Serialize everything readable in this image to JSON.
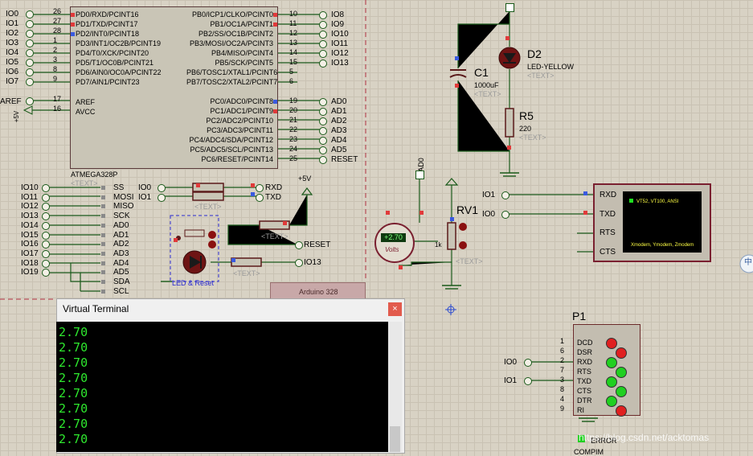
{
  "mcu": {
    "name": "ATMEGA328P",
    "text_tag": "<TEXT>",
    "left_pins": [
      {
        "num": "26",
        "name": "PD0/RXD/PCINT16",
        "net": "IO0"
      },
      {
        "num": "27",
        "name": "PD1/TXD/PCINT17",
        "net": "IO1"
      },
      {
        "num": "28",
        "name": "PD2/INT0/PCINT18",
        "net": "IO2"
      },
      {
        "num": "1",
        "name": "PD3/INT1/OC2B/PCINT19",
        "net": "IO3"
      },
      {
        "num": "2",
        "name": "PD4/T0/XCK/PCINT20",
        "net": "IO4"
      },
      {
        "num": "3",
        "name": "PD5/T1/OC0B/PCINT21",
        "net": "IO5"
      },
      {
        "num": "8",
        "name": "PD6/AIN0/OC0A/PCINT22",
        "net": "IO6"
      },
      {
        "num": "9",
        "name": "PD7/AIN1/PCINT23",
        "net": "IO7"
      }
    ],
    "aref_pins": [
      {
        "num": "17",
        "name": "AREF",
        "net": "AREF"
      },
      {
        "num": "16",
        "name": "AVCC",
        "net": "+5V"
      }
    ],
    "right_pins_top": [
      {
        "num": "10",
        "name": "PB0/ICP1/CLKO/PCINT0",
        "net": "IO8"
      },
      {
        "num": "11",
        "name": "PB1/OC1A/PCINT1",
        "net": "IO9"
      },
      {
        "num": "12",
        "name": "PB2/SS/OC1B/PCINT2",
        "net": "IO10"
      },
      {
        "num": "13",
        "name": "PB3/MOSI/OC2A/PCINT3",
        "net": "IO11"
      },
      {
        "num": "14",
        "name": "PB4/MISO/PCINT4",
        "net": "IO12"
      },
      {
        "num": "15",
        "name": "PB5/SCK/PCINT5",
        "net": "IO13"
      },
      {
        "num": "5",
        "name": "PB6/TOSC1/XTAL1/PCINT6",
        "net": ""
      },
      {
        "num": "6",
        "name": "PB7/TOSC2/XTAL2/PCINT7",
        "net": ""
      }
    ],
    "right_pins_bottom": [
      {
        "num": "19",
        "name": "PC0/ADC0/PCINT8",
        "net": "AD0"
      },
      {
        "num": "20",
        "name": "PC1/ADC1/PCINT9",
        "net": "AD1"
      },
      {
        "num": "21",
        "name": "PC2/ADC2/PCINT10",
        "net": "AD2"
      },
      {
        "num": "22",
        "name": "PC3/ADC3/PCINT11",
        "net": "AD3"
      },
      {
        "num": "23",
        "name": "PC4/ADC4/SDA/PCINT12",
        "net": "AD4"
      },
      {
        "num": "24",
        "name": "PC5/ADC5/SCL/PCINT13",
        "net": "AD5"
      },
      {
        "num": "25",
        "name": "PC6/RESET/PCINT14",
        "net": "RESET"
      }
    ]
  },
  "header_nets": [
    {
      "net": "IO10",
      "label": "SS"
    },
    {
      "net": "IO11",
      "label": "MOSI"
    },
    {
      "net": "IO12",
      "label": "MISO"
    },
    {
      "net": "IO13",
      "label": "SCK"
    },
    {
      "net": "IO14",
      "label": "AD0"
    },
    {
      "net": "IO15",
      "label": "AD1"
    },
    {
      "net": "IO16",
      "label": "AD2"
    },
    {
      "net": "IO17",
      "label": "AD3"
    },
    {
      "net": "IO18",
      "label": "AD4"
    },
    {
      "net": "IO19",
      "label": "AD5"
    },
    {
      "net": "",
      "label": "SDA"
    },
    {
      "net": "",
      "label": "SCL"
    }
  ],
  "serial_links": [
    {
      "left": "IO0",
      "right": "RXD"
    },
    {
      "left": "IO1",
      "right": "TXD"
    }
  ],
  "plus5v": "+5V",
  "reset_block": {
    "label": "LED & Reset",
    "net_reset": "RESET",
    "net_io13": "IO13",
    "text_tag": "<TEXT>"
  },
  "arduino_label": "Arduino 328",
  "capacitor": {
    "ref": "C1",
    "value": "1000uF",
    "text_tag": "<TEXT>"
  },
  "led": {
    "ref": "D2",
    "value": "LED-YELLOW",
    "text_tag": "<TEXT>"
  },
  "resistor": {
    "ref": "R5",
    "value": "220",
    "text_tag": "<TEXT>"
  },
  "pot": {
    "ref": "RV1",
    "value": "1k",
    "net": "AD0",
    "text_tag": "<TEXT>"
  },
  "voltmeter": {
    "reading": "+2.70",
    "unit": "Volts"
  },
  "terminal_device": {
    "pins": [
      "RXD",
      "TXD",
      "RTS",
      "CTS"
    ],
    "nets": [
      "IO1",
      "IO0"
    ],
    "screen_line1": "VT52, VT100, ANSI",
    "screen_line2": "Xmodem, Ymodem, Zmodem"
  },
  "p1": {
    "ref": "P1",
    "pins": [
      {
        "num": "1",
        "name": "DCD",
        "color": "#e02020"
      },
      {
        "num": "6",
        "name": "DSR",
        "color": "#e02020"
      },
      {
        "num": "2",
        "name": "RXD",
        "color": "#20d020"
      },
      {
        "num": "7",
        "name": "RTS",
        "color": "#20d020"
      },
      {
        "num": "3",
        "name": "TXD",
        "color": "#20d020"
      },
      {
        "num": "8",
        "name": "CTS",
        "color": "#20d020"
      },
      {
        "num": "4",
        "name": "DTR",
        "color": "#20d020"
      },
      {
        "num": "9",
        "name": "RI",
        "color": "#e02020"
      }
    ],
    "nets": [
      "IO0",
      "IO1"
    ],
    "error_label": "ERROR",
    "bottom_label": "COMPIM"
  },
  "terminal_window": {
    "title": "Virtual Terminal",
    "close": "×",
    "lines": [
      "2.70",
      "2.70",
      "2.70",
      "2.70",
      "2.70",
      "2.70",
      "2.70",
      "2.70"
    ]
  },
  "watermark": "https://blog.csdn.net/acktomas",
  "edge_icon": "中"
}
